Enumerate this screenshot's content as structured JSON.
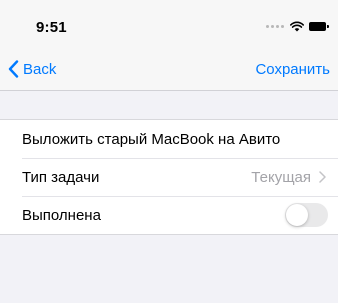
{
  "status_bar": {
    "time": "9:51"
  },
  "nav": {
    "back_label": "Back",
    "save_label": "Сохранить"
  },
  "form": {
    "title_value": "Выложить старый MacBook на Авито",
    "type_label": "Тип задачи",
    "type_value": "Текущая",
    "done_label": "Выполнена",
    "done_on": false
  },
  "icons": {
    "back": "chevron-left-icon",
    "disclosure": "chevron-right-icon",
    "wifi": "wifi-icon",
    "battery": "battery-icon",
    "signal": "signal-dots-icon"
  },
  "colors": {
    "accent": "#007aff",
    "background": "#f2f2f7",
    "secondary_text": "#a3a3a8",
    "toggle_off": "#e9e9ea"
  }
}
